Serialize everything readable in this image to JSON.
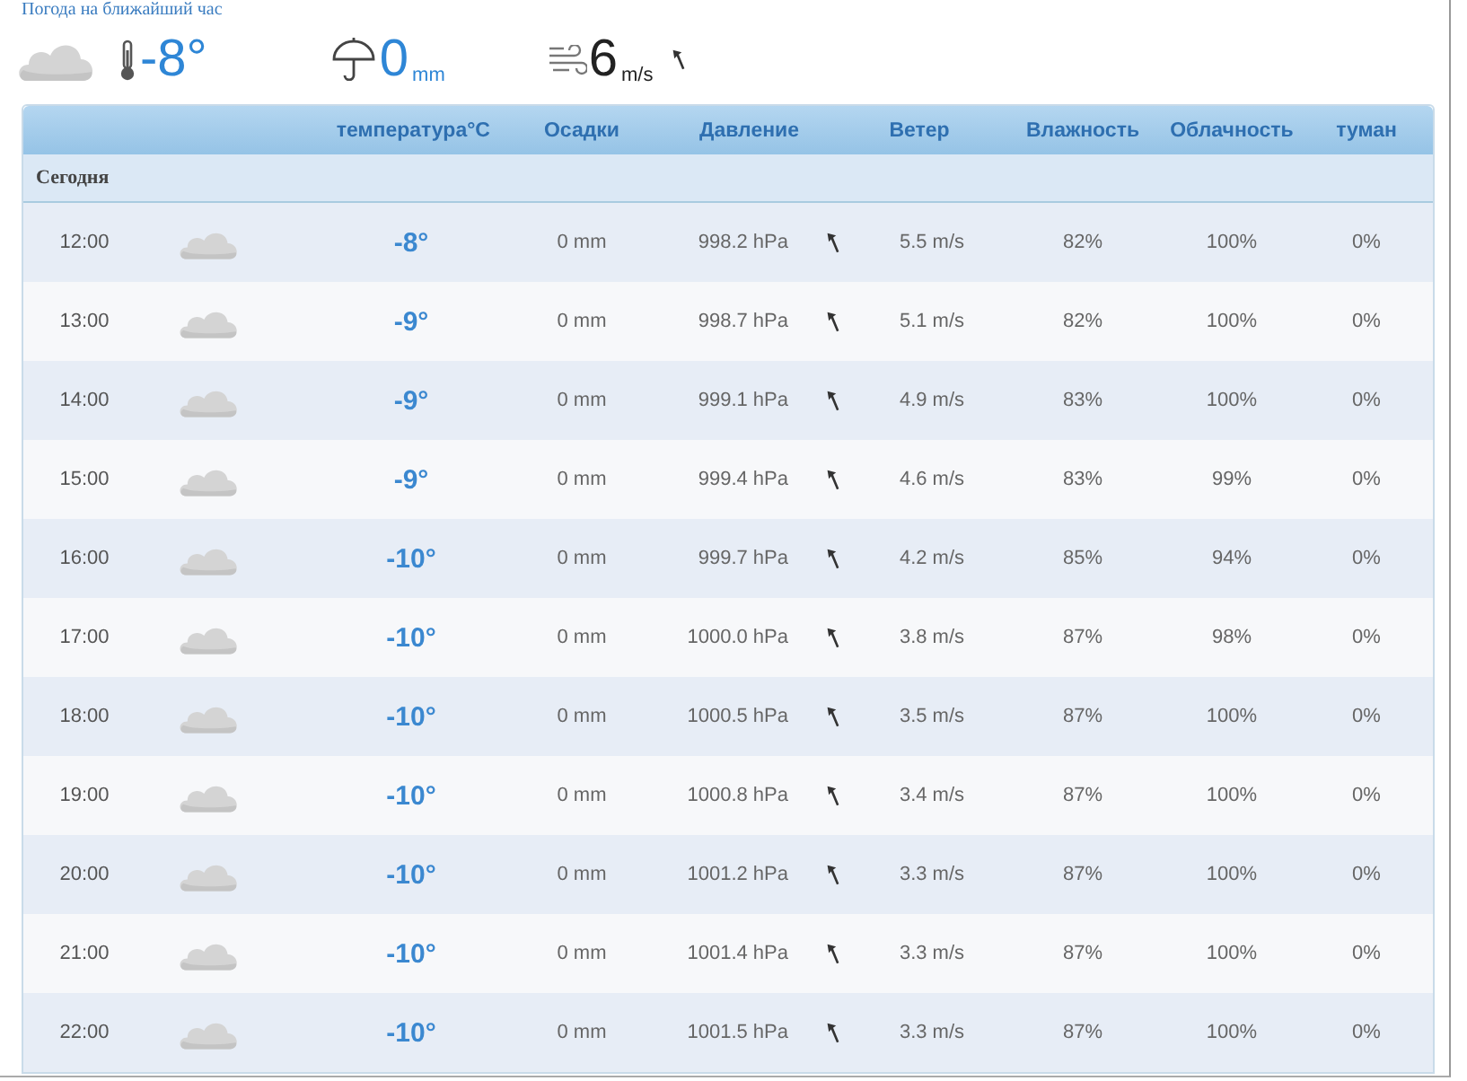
{
  "page_title": "Погода на ближайший час",
  "current": {
    "temperature": "-8°",
    "precipitation": "0",
    "precipitation_unit": "mm",
    "wind": "6",
    "wind_unit": "m/s"
  },
  "table": {
    "columns": [
      "температура°C",
      "Осадки",
      "Давление",
      "Ветер",
      "Влажность",
      "Облачность",
      "туман"
    ],
    "section": "Сегодня",
    "rows": [
      {
        "time": "12:00",
        "temperature": "-8°",
        "precipitation": "0 mm",
        "pressure": "998.2 hPa",
        "wind": "5.5 m/s",
        "humidity": "82%",
        "cloudiness": "100%",
        "fog": "0%"
      },
      {
        "time": "13:00",
        "temperature": "-9°",
        "precipitation": "0 mm",
        "pressure": "998.7 hPa",
        "wind": "5.1 m/s",
        "humidity": "82%",
        "cloudiness": "100%",
        "fog": "0%"
      },
      {
        "time": "14:00",
        "temperature": "-9°",
        "precipitation": "0 mm",
        "pressure": "999.1 hPa",
        "wind": "4.9 m/s",
        "humidity": "83%",
        "cloudiness": "100%",
        "fog": "0%"
      },
      {
        "time": "15:00",
        "temperature": "-9°",
        "precipitation": "0 mm",
        "pressure": "999.4 hPa",
        "wind": "4.6 m/s",
        "humidity": "83%",
        "cloudiness": "99%",
        "fog": "0%"
      },
      {
        "time": "16:00",
        "temperature": "-10°",
        "precipitation": "0 mm",
        "pressure": "999.7 hPa",
        "wind": "4.2 m/s",
        "humidity": "85%",
        "cloudiness": "94%",
        "fog": "0%"
      },
      {
        "time": "17:00",
        "temperature": "-10°",
        "precipitation": "0 mm",
        "pressure": "1000.0 hPa",
        "wind": "3.8 m/s",
        "humidity": "87%",
        "cloudiness": "98%",
        "fog": "0%"
      },
      {
        "time": "18:00",
        "temperature": "-10°",
        "precipitation": "0 mm",
        "pressure": "1000.5 hPa",
        "wind": "3.5 m/s",
        "humidity": "87%",
        "cloudiness": "100%",
        "fog": "0%"
      },
      {
        "time": "19:00",
        "temperature": "-10°",
        "precipitation": "0 mm",
        "pressure": "1000.8 hPa",
        "wind": "3.4 m/s",
        "humidity": "87%",
        "cloudiness": "100%",
        "fog": "0%"
      },
      {
        "time": "20:00",
        "temperature": "-10°",
        "precipitation": "0 mm",
        "pressure": "1001.2 hPa",
        "wind": "3.3 m/s",
        "humidity": "87%",
        "cloudiness": "100%",
        "fog": "0%"
      },
      {
        "time": "21:00",
        "temperature": "-10°",
        "precipitation": "0 mm",
        "pressure": "1001.4 hPa",
        "wind": "3.3 m/s",
        "humidity": "87%",
        "cloudiness": "100%",
        "fog": "0%"
      },
      {
        "time": "22:00",
        "temperature": "-10°",
        "precipitation": "0 mm",
        "pressure": "1001.5 hPa",
        "wind": "3.3 m/s",
        "humidity": "87%",
        "cloudiness": "100%",
        "fog": "0%"
      }
    ]
  }
}
